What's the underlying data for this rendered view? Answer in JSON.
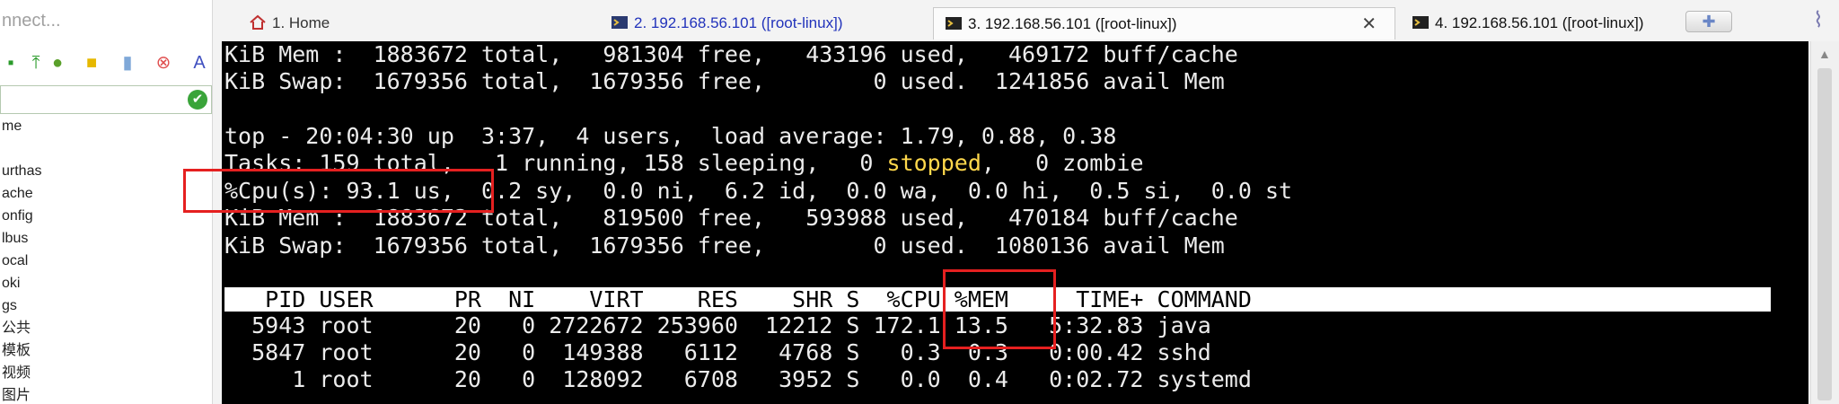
{
  "sidebar": {
    "connect_placeholder": "nnect...",
    "tree_items": [
      "me",
      "",
      "urthas",
      "ache",
      "onfig",
      "lbus",
      "ocal",
      "oki",
      "gs",
      "公共",
      "模板",
      "视频",
      "图片"
    ]
  },
  "tabs": [
    {
      "label": "1. Home",
      "icon": "home-icon"
    },
    {
      "label": "2. 192.168.56.101 ([root-linux])",
      "icon": "terminal-icon"
    },
    {
      "label": "3. 192.168.56.101 ([root-linux])",
      "icon": "terminal-icon",
      "active": true
    },
    {
      "label": "4. 192.168.56.101 ([root-linux])",
      "icon": "terminal-icon"
    }
  ],
  "terminal": {
    "mem_line_1": "KiB Mem :  1883672 total,   981304 free,   433196 used,   469172 buff/cache",
    "swap_line_1": "KiB Swap:  1679356 total,  1679356 free,        0 used.  1241856 avail Mem",
    "top_line": "top - 20:04:30 up  3:37,  4 users,  load average: 1.79, 0.88, 0.38",
    "tasks_pre": "Tasks: 159 total,   1 running, 158 sleeping,   0 ",
    "tasks_stopped": "stopped",
    "tasks_post": ",   0 zombie",
    "cpu_line": "%Cpu(s): 93.1 us,  0.2 sy,  0.0 ni,  6.2 id,  0.0 wa,  0.0 hi,  0.5 si,  0.0 st",
    "mem_line_2": "KiB Mem :  1883672 total,   819500 free,   593988 used,   470184 buff/cache",
    "swap_line_2": "KiB Swap:  1679356 total,  1679356 free,        0 used.  1080136 avail Mem",
    "table_header": "   PID USER      PR  NI    VIRT    RES    SHR S  %CPU %MEM     TIME+ COMMAND",
    "rows": [
      "  5943 root      20   0 2722672 253960  12212 S 172.1 13.5   5:32.83 java",
      "  5847 root      20   0  149388   6112   4768 S   0.3  0.3   0:00.42 sshd",
      "     1 root      20   0  128092   6708   3952 S   0.0  0.4   0:02.72 systemd"
    ]
  },
  "colors": {
    "highlight": "#e52020",
    "stopped": "#ffd84c",
    "terminal_bg": "#000000"
  }
}
